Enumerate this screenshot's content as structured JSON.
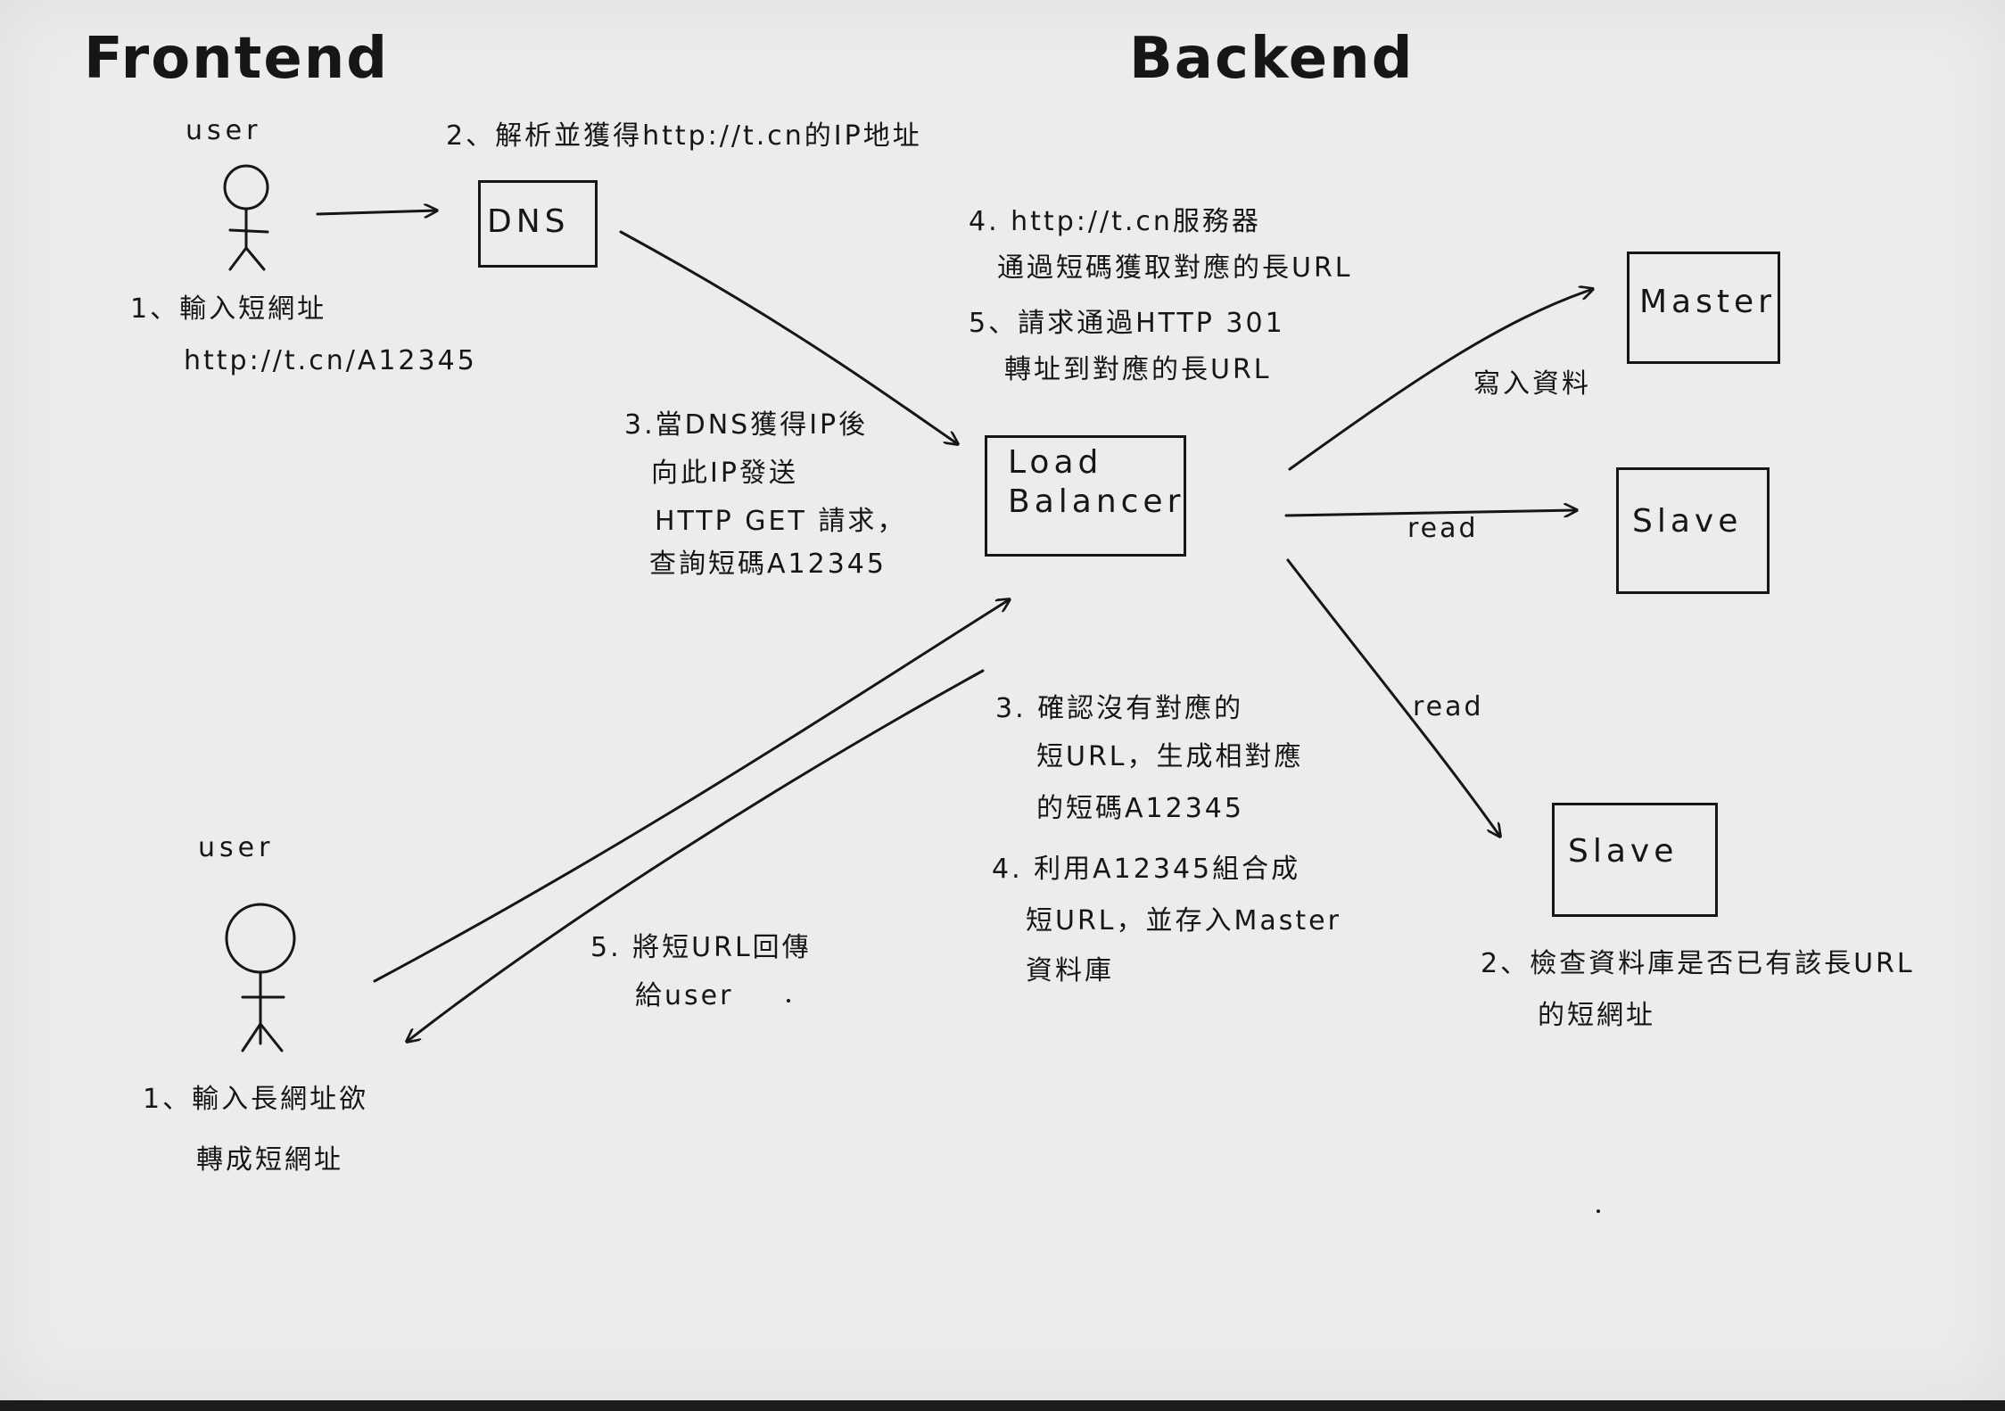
{
  "headings": {
    "frontend": "Frontend",
    "backend": "Backend"
  },
  "actors": {
    "user_top": "user",
    "user_bottom": "user"
  },
  "nodes": {
    "dns": "DNS",
    "load_balancer_line1": "Load",
    "load_balancer_line2": "Balancer",
    "master": "Master",
    "slave_top": "Slave",
    "slave_bottom": "Slave"
  },
  "read_flow": {
    "step1_line1": "1、輸入短網址",
    "step1_line2": "http://t.cn/A12345",
    "step2": "2、解析並獲得http://t.cn的IP地址",
    "step3_line1": "3.當DNS獲得IP後",
    "step3_line2": "向此IP發送",
    "step3_line3": "HTTP GET 請求，",
    "step3_line4": "查詢短碼A12345",
    "step4_line1": "4. http://t.cn服務器",
    "step4_line2": "通過短碼獲取對應的長URL",
    "step5_line1": "5、請求通過HTTP 301",
    "step5_line2": "轉址到對應的長URL"
  },
  "write_flow": {
    "step1_line1": "1、輸入長網址欲",
    "step1_line2": "轉成短網址",
    "step2_line1": "2、檢查資料庫是否已有該長URL",
    "step2_line2": "的短網址",
    "step3_line1": "3. 確認沒有對應的",
    "step3_line2": "短URL，生成相對應",
    "step3_line3": "的短碼A12345",
    "step4_line1": "4. 利用A12345組合成",
    "step4_line2": "短URL，並存入Master",
    "step4_line3": "資料庫",
    "step5_line1": "5. 將短URL回傳",
    "step5_line2": "給user"
  },
  "edge_labels": {
    "master_write": "寫入資料",
    "slave_top_read": "read",
    "slave_bottom_read": "read"
  },
  "colors": {
    "paper": "#ececeb",
    "ink": "#161616",
    "background": "#1c1c1c"
  }
}
